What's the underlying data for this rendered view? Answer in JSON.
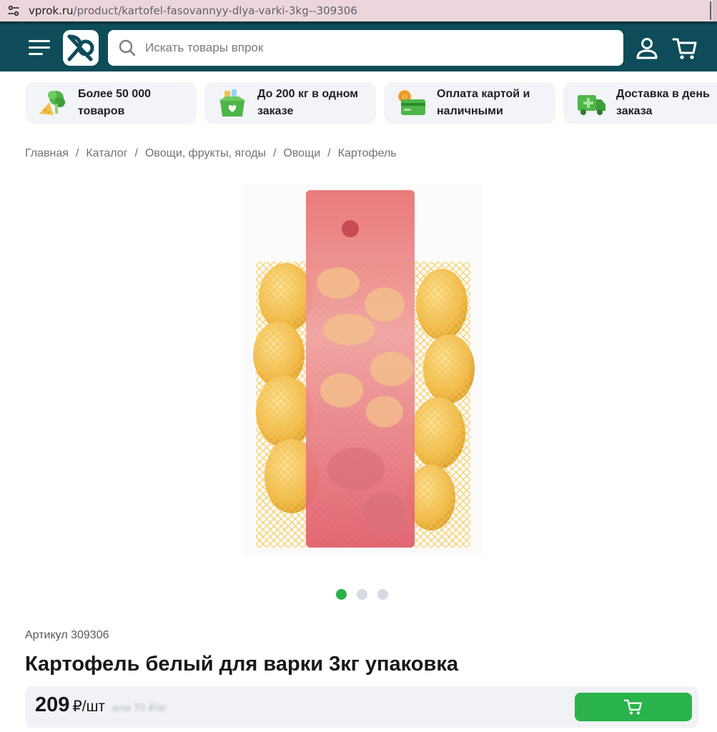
{
  "browser": {
    "url_host": "vprok.ru",
    "url_path": "/product/kartofel-fasovannyy-dlya-varki-3kg--309306"
  },
  "header": {
    "search_placeholder": "Искать товары впрок",
    "brand_color": "#0e4c5a",
    "icons": [
      "menu-icon",
      "logo",
      "search-icon",
      "user-icon",
      "cart-icon"
    ]
  },
  "features": [
    {
      "label": "Более 50 000 товаров",
      "icon": "vegetables-icon"
    },
    {
      "label": "До 200 кг в одном заказе",
      "icon": "grocery-box-icon"
    },
    {
      "label": "Оплата картой и наличными",
      "icon": "payment-card-icon"
    },
    {
      "label": "Доставка в день заказа",
      "icon": "delivery-truck-icon"
    }
  ],
  "breadcrumbs": [
    "Главная",
    "Каталог",
    "Овощи, фрукты, ягоды",
    "Овощи",
    "Картофель"
  ],
  "breadcrumb_separator": "/",
  "gallery": {
    "image": "potatoes-in-net-bag",
    "slides": 3,
    "active_slide": 1,
    "active_color": "#29b34a"
  },
  "product": {
    "article": "Артикул 309306",
    "title": "Картофель белый для варки 3кг упаковка",
    "price": "209",
    "price_unit": "₽/шт",
    "price_note_blurred": "или 70 ₽/кг",
    "add_to_cart_icon": "cart-icon",
    "accent_color": "#29b34a"
  }
}
